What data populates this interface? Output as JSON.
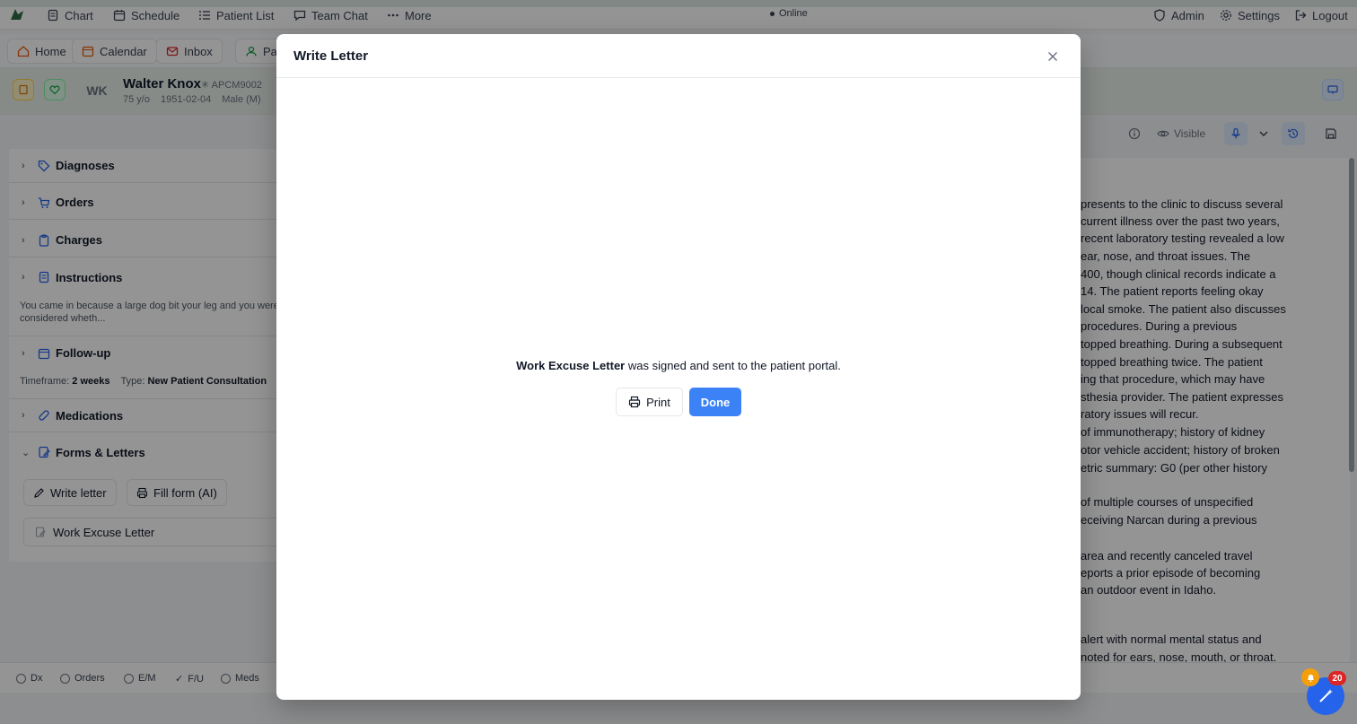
{
  "topnav": {
    "items": [
      {
        "label": "Chart",
        "icon": "document-icon"
      },
      {
        "label": "Schedule",
        "icon": "calendar-icon"
      },
      {
        "label": "Patient List",
        "icon": "list-icon"
      },
      {
        "label": "Team Chat",
        "icon": "chat-icon"
      },
      {
        "label": "More",
        "icon": "ellipsis-icon"
      }
    ],
    "status": "Online",
    "right": [
      {
        "label": "Admin",
        "icon": "shield-icon"
      },
      {
        "label": "Settings",
        "icon": "gear-icon"
      },
      {
        "label": "Logout",
        "icon": "logout-icon"
      }
    ]
  },
  "tabs": [
    {
      "label": "Home",
      "icon": "home-icon"
    },
    {
      "label": "Calendar",
      "icon": "calendar-icon"
    },
    {
      "label": "Inbox",
      "icon": "inbox-icon"
    },
    {
      "label": "Pat",
      "icon": "user-icon"
    }
  ],
  "patient": {
    "initials": "WK",
    "name": "Walter Knox",
    "id": "APCM9002",
    "age": "75 y/o",
    "dob": "1951-02-04",
    "sex": "Male (M)"
  },
  "sections": {
    "diagnoses": "Diagnoses",
    "orders": "Orders",
    "charges": "Charges",
    "instructions": "Instructions",
    "instructions_text_1": "You came in because a large dog bit your leg and you were",
    "instructions_text_2": "considered wheth...",
    "followup": "Follow-up",
    "timeframe_label": "Timeframe:",
    "timeframe_value": "2 weeks",
    "type_label": "Type:",
    "type_value": "New Patient Consultation",
    "medications": "Medications",
    "forms": "Forms & Letters",
    "write_letter": "Write letter",
    "fill_form": "Fill form (AI)",
    "doc_name": "Work Excuse Letter"
  },
  "right_toolbar": {
    "visible_label": "Visible"
  },
  "notes_lines": [
    "presents to the clinic to discuss several",
    "current illness over the past two years,",
    "recent laboratory testing revealed a low",
    "ear, nose, and throat issues. The",
    "400, though clinical records indicate a",
    "14. The patient reports feeling okay",
    "local smoke. The patient also discusses",
    "procedures. During a previous",
    "topped breathing. During a subsequent",
    "topped breathing twice. The patient",
    "ing that procedure, which may have",
    "sthesia provider. The patient expresses",
    "ratory issues will recur.",
    "of immunotherapy; history of kidney",
    "otor vehicle accident; history of broken",
    "etric summary: G0 (per other history",
    "of multiple courses of unspecified",
    "eceiving Narcan during a previous",
    "area and recently canceled travel",
    "eports a prior episode of becoming",
    "an outdoor event in Idaho.",
    "alert with normal mental status and",
    "noted for ears, nose, mouth, or throat."
  ],
  "bottom_checks": [
    {
      "label": "Dx",
      "checked": false
    },
    {
      "label": "Orders",
      "checked": false
    },
    {
      "label": "E/M",
      "checked": false
    },
    {
      "label": "F/U",
      "checked": true
    },
    {
      "label": "Meds",
      "checked": false
    }
  ],
  "modal": {
    "title": "Write Letter",
    "message_bold": "Work Excuse Letter",
    "message_rest": " was signed and sent to the patient portal.",
    "print_label": "Print",
    "done_label": "Done"
  },
  "fab": {
    "badge": "20"
  },
  "colors": {
    "accent": "#3b82f6",
    "badge": "#dc2626",
    "bell": "#f59e0b"
  }
}
